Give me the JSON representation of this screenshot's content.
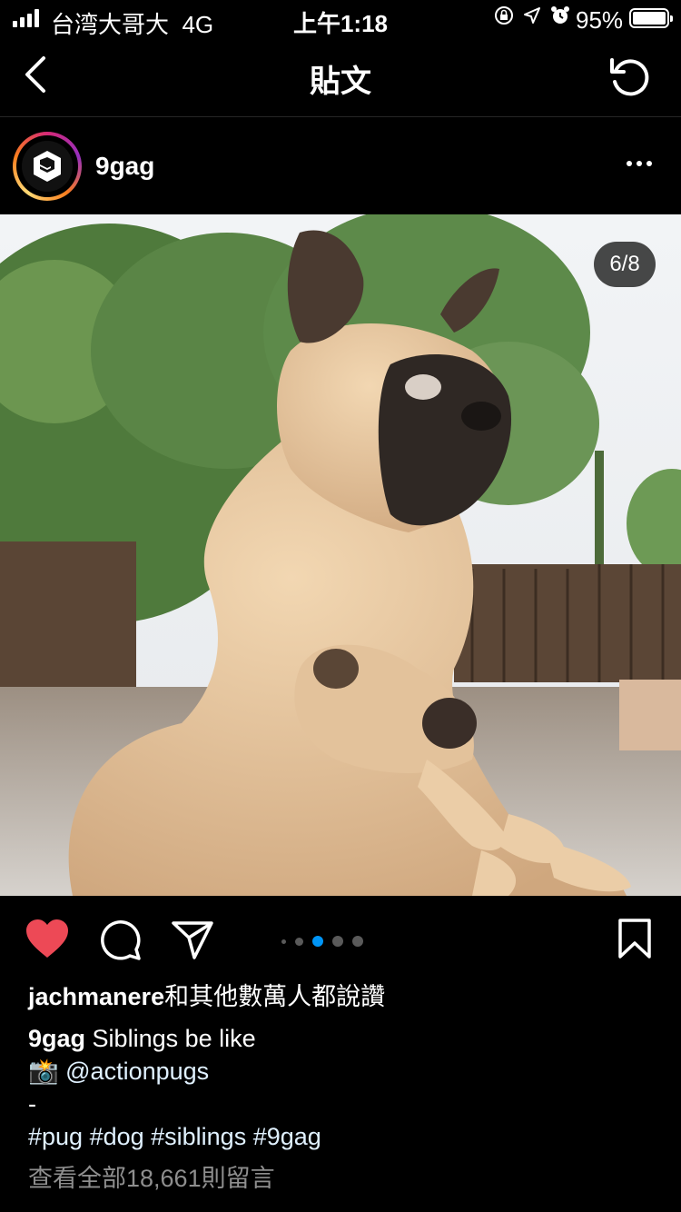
{
  "status_bar": {
    "carrier": "台湾大哥大",
    "network": "4G",
    "time": "上午1:18",
    "battery": "95%",
    "icons": [
      "orientation-lock-icon",
      "location-icon",
      "alarm-icon"
    ]
  },
  "nav": {
    "title": "貼文",
    "back_icon": "chevron-left-icon",
    "refresh_icon": "refresh-icon"
  },
  "post": {
    "username": "9gag",
    "avatar_icon": "9gag-logo",
    "more_icon": "more-horizontal-icon",
    "image_counter": "6/8",
    "carousel": {
      "total_dots": 5,
      "active_index": 2
    }
  },
  "actions": {
    "like_icon": "heart-filled-icon",
    "comment_icon": "comment-icon",
    "share_icon": "send-icon",
    "save_icon": "bookmark-icon",
    "like_color": "#ed4956",
    "active_dot_color": "#0095f6"
  },
  "likes": {
    "user": "jachmanere",
    "text": "和其他數萬人都說讚"
  },
  "caption": {
    "user": "9gag",
    "text": "Siblings be like",
    "emoji": "📸",
    "mention": "@actionpugs",
    "dash": "-",
    "hashtags": "#pug #dog #siblings #9gag"
  },
  "comments": {
    "view_all": "查看全部18,661則留言"
  }
}
